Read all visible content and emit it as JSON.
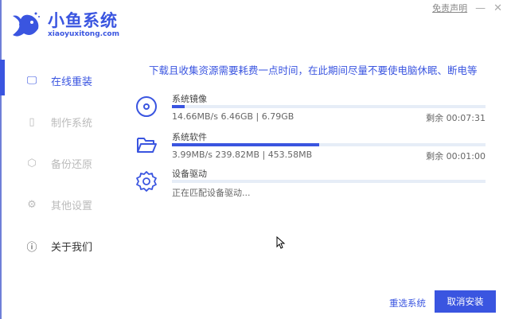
{
  "app": {
    "name": "小鱼系统",
    "domain": "xiaoyuxitong.com"
  },
  "header": {
    "disclaimer": "免责声明",
    "minimize": "—",
    "close": "✕"
  },
  "sidebar": {
    "items": [
      {
        "label": "在线重装",
        "icon": "monitor-icon",
        "state": "active"
      },
      {
        "label": "制作系统",
        "icon": "usb-icon",
        "state": "disabled"
      },
      {
        "label": "备份还原",
        "icon": "backup-icon",
        "state": "disabled"
      },
      {
        "label": "其他设置",
        "icon": "gear-icon",
        "state": "disabled"
      },
      {
        "label": "关于我们",
        "icon": "info-icon",
        "state": "normal"
      }
    ]
  },
  "notice": "下载且收集资源需要耗费一点时间，在此期间尽量不要使电脑休眠、断电等",
  "downloads": [
    {
      "title": "系统镜像",
      "icon": "disc-icon",
      "stats": "14.66MB/s 6.46GB | 6.79GB",
      "remaining": "剩余 00:07:31",
      "progress": 0.04
    },
    {
      "title": "系统软件",
      "icon": "folder-icon",
      "stats": "3.99MB/s 239.82MB | 453.58MB",
      "remaining": "剩余 00:01:00",
      "progress": 0.47
    },
    {
      "title": "设备驱动",
      "icon": "gear-icon",
      "stats": "正在匹配设备驱动...",
      "progress": 0
    }
  ],
  "buttons": {
    "reselect": "重选系统",
    "cancel": "取消安装"
  },
  "colors": {
    "accent": "#3a55e0"
  }
}
